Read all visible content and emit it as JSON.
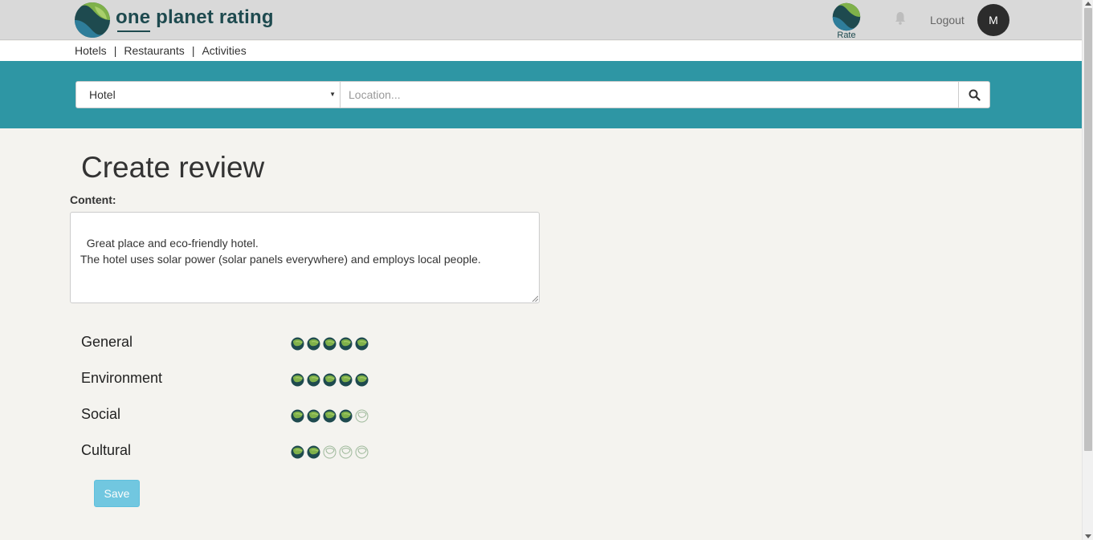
{
  "brand": {
    "name": "one planet rating",
    "primary_color": "#1e4a4f",
    "accent_color": "#2e96a4"
  },
  "header": {
    "rate_label": "Rate",
    "logout_label": "Logout",
    "avatar_initial": "M"
  },
  "subnav": {
    "items": [
      "Hotels",
      "Restaurants",
      "Activities"
    ],
    "separator": "|"
  },
  "search": {
    "type_value": "Hotel",
    "location_placeholder": "Location...",
    "icon": "search-icon"
  },
  "page": {
    "title": "Create review",
    "content_label": "Content:",
    "content_value": "Great place and eco-friendly hotel.\nThe hotel uses solar power (solar panels everywhere) and employs local people."
  },
  "ratings": [
    {
      "label": "General",
      "value": 5,
      "max": 5
    },
    {
      "label": "Environment",
      "value": 5,
      "max": 5
    },
    {
      "label": "Social",
      "value": 4,
      "max": 5
    },
    {
      "label": "Cultural",
      "value": 2,
      "max": 5
    }
  ],
  "actions": {
    "save_label": "Save",
    "save_color": "#5bc0de"
  }
}
